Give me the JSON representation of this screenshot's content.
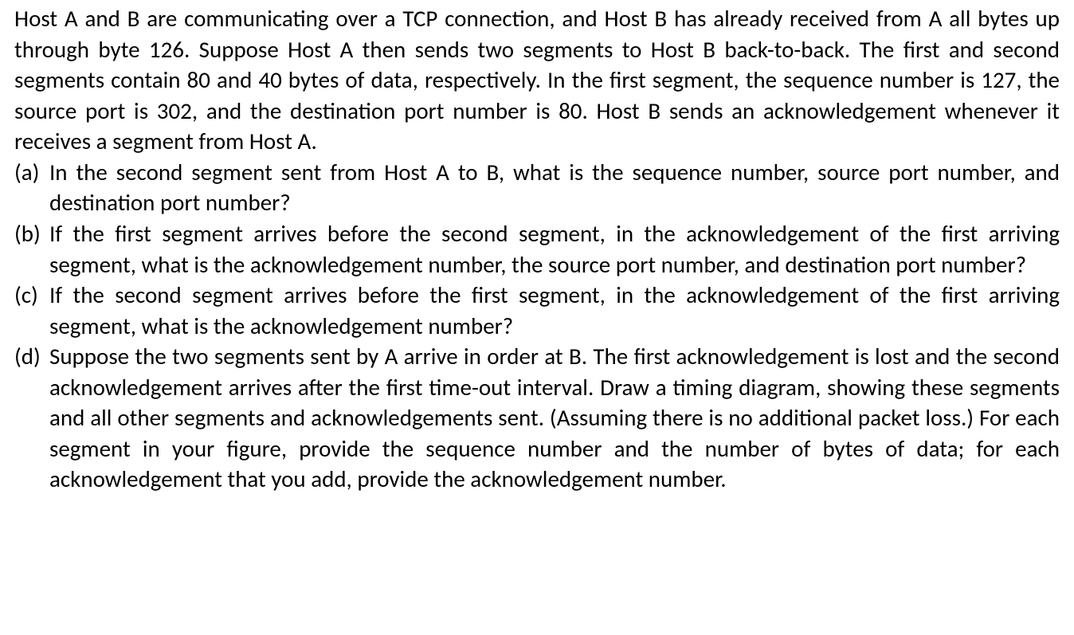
{
  "intro": "Host A and B are communicating over a TCP connection, and Host B has already received from A all bytes up through byte 126. Suppose Host A then sends two segments to Host B back-to-back. The first and second segments contain 80 and 40 bytes of data, respectively. In the first segment, the sequence number is 127, the source port is 302, and the destination port number is 80. Host B sends an acknowledgement whenever it receives a segment from Host A.",
  "questions": [
    {
      "marker": "(a)",
      "text": "In the second segment sent from Host A to B, what is the sequence number, source port number, and destination port number?"
    },
    {
      "marker": "(b)",
      "text": "If the first segment arrives before the second segment, in the acknowledgement of the first arriving segment, what is the acknowledgement number, the source port number, and destination port number?"
    },
    {
      "marker": "(c)",
      "text": "If the second segment arrives before the first segment, in the acknowledgement of the first arriving segment, what is the acknowledgement number?"
    },
    {
      "marker": "(d)",
      "text": "Suppose the two segments sent by A arrive in order at B. The first acknowledgement is lost and the second acknowledgement arrives after the first time-out interval. Draw a timing diagram, showing these segments and all other segments and acknowledgements sent. (Assuming there is no additional packet loss.) For each segment in your figure, provide the sequence number and the number of bytes of data; for each acknowledgement that you add, provide the acknowledgement number."
    }
  ]
}
